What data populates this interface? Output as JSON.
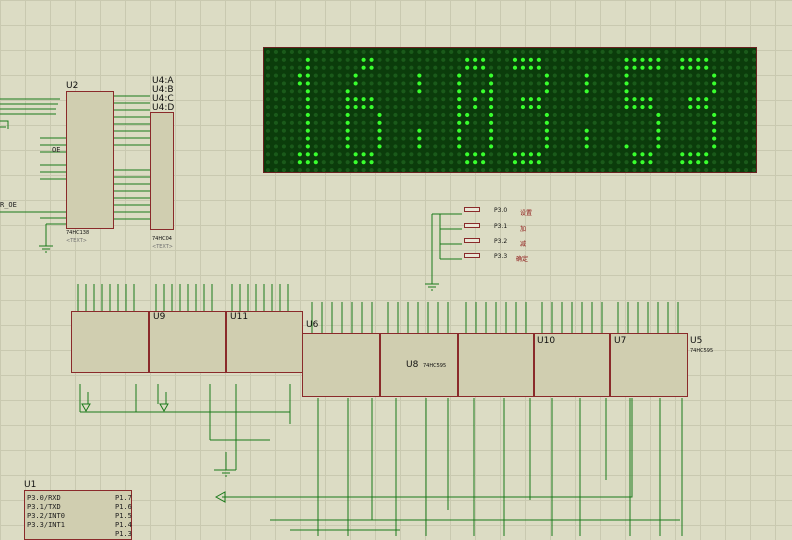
{
  "schematic": {
    "chips": {
      "u2": {
        "ref": "U2",
        "part": "74HC138",
        "text": "<TEXT>"
      },
      "u4": {
        "refs": [
          "U4:A",
          "U4:B",
          "U4:C",
          "U4:D"
        ],
        "part": "74HC04",
        "text": "<TEXT>"
      },
      "u1": {
        "ref": "U1",
        "pins_left": [
          "P3.0/RXD",
          "P3.1/TXD",
          "P3.2/INT0",
          "P3.3/INT1"
        ],
        "pins_right": [
          "P1.7",
          "P1.6",
          "P1.5",
          "P1.4",
          "P1.3"
        ]
      },
      "u6": {
        "ref": "U6",
        "part": "74HC595"
      },
      "u7": {
        "ref": "U7",
        "part": "74HC595"
      },
      "u8": {
        "ref": "U8",
        "part": "74HC595"
      },
      "u5": {
        "ref": "U5",
        "part": "74HC595"
      },
      "u9": {
        "ref": "U9",
        "part": "74HC595"
      },
      "u10": {
        "ref": "U10",
        "part": "74HC595"
      },
      "u11": {
        "ref": "U11",
        "part": "74HC595"
      }
    },
    "signals": {
      "gate": "R_OE",
      "oe": "OE"
    },
    "buttons": [
      {
        "pin": "P3.0",
        "label": "设置"
      },
      {
        "pin": "P3.1",
        "label": "加"
      },
      {
        "pin": "P3.2",
        "label": "减"
      },
      {
        "pin": "P3.3",
        "label": "确定"
      }
    ],
    "display": {
      "digits": "16:03:53",
      "color_on": "#39ff2e",
      "color_off": "#1a5a1a"
    },
    "colors": {
      "wire": "#1a7a1a",
      "chip_border": "#8a2a2a",
      "chip_fill": "#d0ceb0",
      "background": "#dcdcc4"
    }
  }
}
